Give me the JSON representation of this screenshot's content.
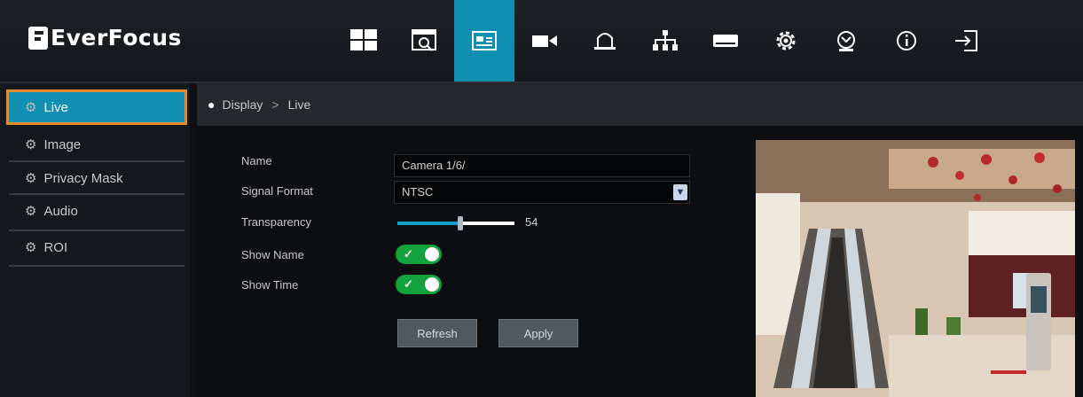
{
  "brand": {
    "name": "EverFocus"
  },
  "nav": {
    "items": [
      {
        "name": "layout-grid-icon",
        "active": false
      },
      {
        "name": "playback-icon",
        "active": false
      },
      {
        "name": "display-settings-icon",
        "active": true
      },
      {
        "name": "camera-icon",
        "active": false
      },
      {
        "name": "alarm-bell-icon",
        "active": false
      },
      {
        "name": "network-icon",
        "active": false
      },
      {
        "name": "storage-icon",
        "active": false
      },
      {
        "name": "settings-gear-icon",
        "active": false
      },
      {
        "name": "maintenance-icon",
        "active": false
      },
      {
        "name": "info-icon",
        "active": false
      },
      {
        "name": "logout-icon",
        "active": false
      }
    ]
  },
  "sidebar": {
    "items": [
      {
        "label": "Live",
        "active": true
      },
      {
        "label": "Image",
        "active": false
      },
      {
        "label": "Privacy Mask",
        "active": false
      },
      {
        "label": "Audio",
        "active": false
      },
      {
        "label": "ROI",
        "active": false
      }
    ]
  },
  "breadcrumb": {
    "root": "Display",
    "separator": ">",
    "current": "Live"
  },
  "form": {
    "name_label": "Name",
    "name_value": "Camera 1/6/",
    "signal_label": "Signal Format",
    "signal_value": "NTSC",
    "transparency_label": "Transparency",
    "transparency_value": "54",
    "show_name_label": "Show Name",
    "show_name_on": true,
    "show_time_label": "Show Time",
    "show_time_on": true,
    "check_glyph": "✓"
  },
  "buttons": {
    "refresh": "Refresh",
    "apply": "Apply"
  },
  "colors": {
    "accent": "#0e8fb1",
    "active_outline": "#e68a2e",
    "toggle_on": "#13a23c"
  }
}
